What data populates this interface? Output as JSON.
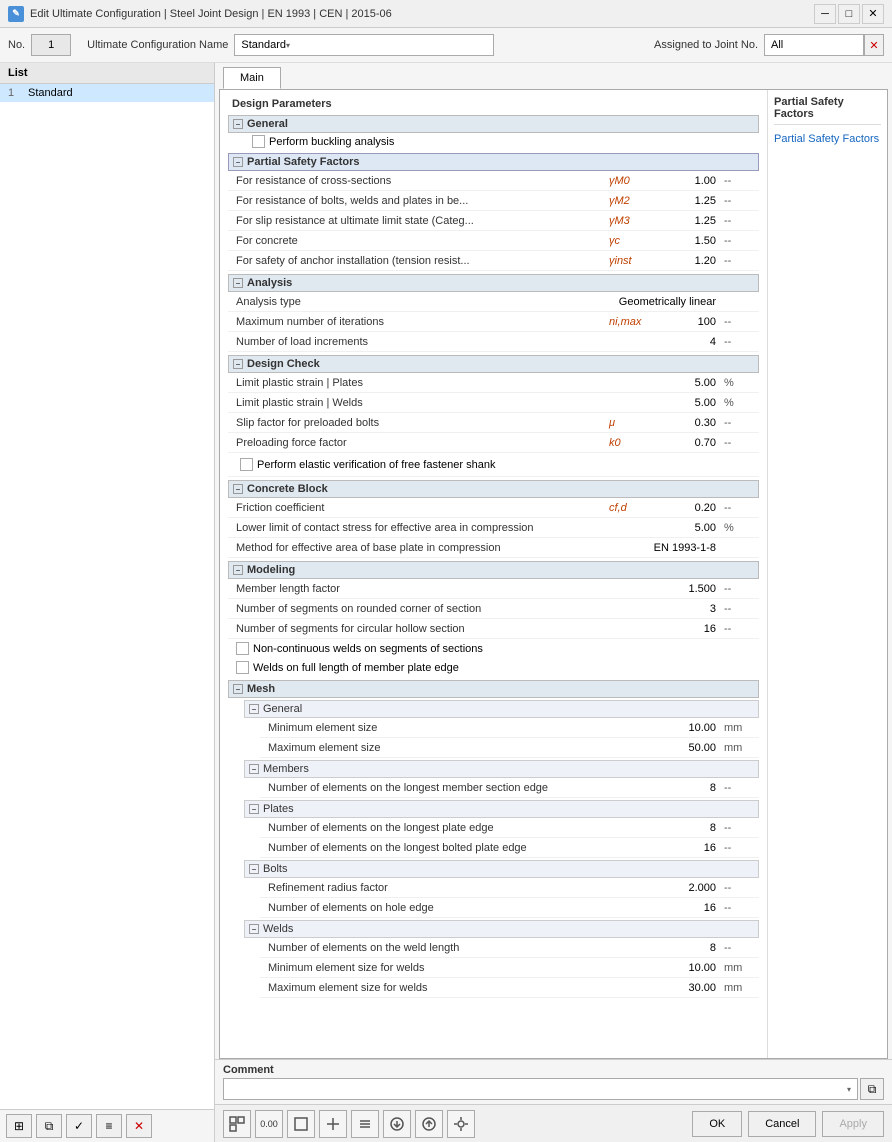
{
  "titleBar": {
    "title": "Edit Ultimate Configuration | Steel Joint Design | EN 1993 | CEN | 2015-06",
    "icon": "✎"
  },
  "list": {
    "header": "List",
    "items": [
      {
        "num": "1",
        "name": "Standard"
      }
    ]
  },
  "configHeader": {
    "noLabel": "No.",
    "noValue": "1",
    "nameLabel": "Ultimate Configuration Name",
    "nameValue": "Standard",
    "assignedLabel": "Assigned to Joint No.",
    "assignedValue": "All"
  },
  "tabs": [
    "Main"
  ],
  "activeTab": "Main",
  "designParamsTitle": "Design Parameters",
  "sections": {
    "general": {
      "label": "General",
      "params": [
        {
          "label": "Perform buckling analysis",
          "type": "checkbox",
          "checked": false
        }
      ]
    },
    "partialSafetyFactors": {
      "label": "Partial Safety Factors",
      "params": [
        {
          "label": "For resistance of cross-sections",
          "symbol": "γM0",
          "value": "1.00",
          "unit": "--"
        },
        {
          "label": "For resistance of bolts, welds and plates in be...",
          "symbol": "γM2",
          "value": "1.25",
          "unit": "--"
        },
        {
          "label": "For slip resistance at ultimate limit state (Categ...",
          "symbol": "γM3",
          "value": "1.25",
          "unit": "--"
        },
        {
          "label": "For concrete",
          "symbol": "γc",
          "value": "1.50",
          "unit": "--"
        },
        {
          "label": "For safety of anchor installation (tension resist...",
          "symbol": "γinst",
          "value": "1.20",
          "unit": "--"
        }
      ]
    },
    "analysis": {
      "label": "Analysis",
      "params": [
        {
          "label": "Analysis type",
          "symbol": "",
          "value": "Geometrically linear",
          "unit": ""
        },
        {
          "label": "Maximum number of iterations",
          "symbol": "ni,max",
          "value": "100",
          "unit": "--"
        },
        {
          "label": "Number of load increments",
          "symbol": "",
          "value": "4",
          "unit": "--"
        }
      ]
    },
    "designCheck": {
      "label": "Design Check",
      "params": [
        {
          "label": "Limit plastic strain | Plates",
          "symbol": "",
          "value": "5.00",
          "unit": "%"
        },
        {
          "label": "Limit plastic strain | Welds",
          "symbol": "",
          "value": "5.00",
          "unit": "%"
        },
        {
          "label": "Slip factor for preloaded bolts",
          "symbol": "μ",
          "value": "0.30",
          "unit": "--"
        },
        {
          "label": "Preloading force factor",
          "symbol": "k0",
          "value": "0.70",
          "unit": "--"
        },
        {
          "label": "Perform elastic verification of free fastener shank",
          "type": "checkbox",
          "checked": false
        }
      ]
    },
    "concreteBlock": {
      "label": "Concrete Block",
      "params": [
        {
          "label": "Friction coefficient",
          "symbol": "cf,d",
          "value": "0.20",
          "unit": "--"
        },
        {
          "label": "Lower limit of contact stress for effective area in compression",
          "symbol": "",
          "value": "5.00",
          "unit": "%"
        },
        {
          "label": "Method for effective area of base plate in compression",
          "symbol": "",
          "value": "EN 1993-1-8",
          "unit": ""
        }
      ]
    },
    "modeling": {
      "label": "Modeling",
      "params": [
        {
          "label": "Member length factor",
          "symbol": "",
          "value": "1.500",
          "unit": "--"
        },
        {
          "label": "Number of segments on rounded corner of section",
          "symbol": "",
          "value": "3",
          "unit": "--"
        },
        {
          "label": "Number of segments for circular hollow section",
          "symbol": "",
          "value": "16",
          "unit": "--"
        },
        {
          "label": "Non-continuous welds on segments of sections",
          "type": "checkbox",
          "checked": false
        },
        {
          "label": "Welds on full length of member plate edge",
          "type": "checkbox",
          "checked": false
        }
      ]
    },
    "mesh": {
      "label": "Mesh",
      "subSections": {
        "general": {
          "label": "General",
          "params": [
            {
              "label": "Minimum element size",
              "symbol": "",
              "value": "10.00",
              "unit": "mm"
            },
            {
              "label": "Maximum element size",
              "symbol": "",
              "value": "50.00",
              "unit": "mm"
            }
          ]
        },
        "members": {
          "label": "Members",
          "params": [
            {
              "label": "Number of elements on the longest member section edge",
              "symbol": "",
              "value": "8",
              "unit": "--"
            }
          ]
        },
        "plates": {
          "label": "Plates",
          "params": [
            {
              "label": "Number of elements on the longest plate edge",
              "symbol": "",
              "value": "8",
              "unit": "--"
            },
            {
              "label": "Number of elements on the longest bolted plate edge",
              "symbol": "",
              "value": "16",
              "unit": "--"
            }
          ]
        },
        "bolts": {
          "label": "Bolts",
          "params": [
            {
              "label": "Refinement radius factor",
              "symbol": "",
              "value": "2.000",
              "unit": "--"
            },
            {
              "label": "Number of elements on hole edge",
              "symbol": "",
              "value": "16",
              "unit": "--"
            }
          ]
        },
        "welds": {
          "label": "Welds",
          "params": [
            {
              "label": "Number of elements on the weld length",
              "symbol": "",
              "value": "8",
              "unit": "--"
            },
            {
              "label": "Minimum element size for welds",
              "symbol": "",
              "value": "10.00",
              "unit": "mm"
            },
            {
              "label": "Maximum element size for welds",
              "symbol": "",
              "value": "30.00",
              "unit": "mm"
            }
          ]
        }
      }
    }
  },
  "sidebar": {
    "title": "Partial Safety Factors",
    "link": "Partial Safety Factors"
  },
  "comment": {
    "label": "Comment",
    "value": "",
    "placeholder": ""
  },
  "buttons": {
    "ok": "OK",
    "cancel": "Cancel",
    "apply": "Apply"
  },
  "listPanelButtons": [
    {
      "icon": "⊞",
      "name": "add-config"
    },
    {
      "icon": "⧉",
      "name": "copy-config"
    },
    {
      "icon": "✓",
      "name": "confirm-config"
    },
    {
      "icon": "≡",
      "name": "menu-config"
    },
    {
      "icon": "✕",
      "name": "delete-config"
    }
  ],
  "bottomLeftButtons": [
    {
      "icon": "◱",
      "name": "view-btn"
    },
    {
      "icon": "0.00",
      "name": "decimal-btn"
    },
    {
      "icon": "□",
      "name": "units-btn"
    },
    {
      "icon": "⊞",
      "name": "add-btn"
    },
    {
      "icon": "↕",
      "name": "sort-btn"
    },
    {
      "icon": "⊕",
      "name": "import-btn"
    },
    {
      "icon": "⊙",
      "name": "export-btn"
    },
    {
      "icon": "⚙",
      "name": "settings-btn"
    }
  ]
}
